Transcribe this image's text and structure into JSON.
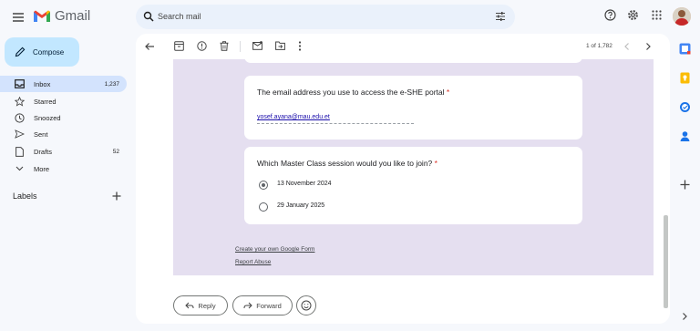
{
  "header": {
    "app_name": "Gmail",
    "search": {
      "placeholder": "Search mail"
    }
  },
  "sidebar": {
    "compose_label": "Compose",
    "items": [
      {
        "label": "Inbox",
        "count": "1,237"
      },
      {
        "label": "Starred",
        "count": ""
      },
      {
        "label": "Snoozed",
        "count": ""
      },
      {
        "label": "Sent",
        "count": ""
      },
      {
        "label": "Drafts",
        "count": "52"
      },
      {
        "label": "More",
        "count": ""
      }
    ],
    "labels_title": "Labels"
  },
  "toolbar": {
    "pager": "1 of 1,782"
  },
  "email": {
    "q1": {
      "title": "The email address you use to access the e-SHE portal",
      "required_mark": "*",
      "answer": "yosef.ayana@mau.edu.et"
    },
    "q2": {
      "title": "Which Master Class session would you like to join?",
      "required_mark": "*",
      "options": [
        {
          "label": "13 November 2024",
          "checked": true
        },
        {
          "label": "29 January 2025",
          "checked": false
        }
      ]
    },
    "footer_links": [
      "Create your own Google Form",
      "Report Abuse"
    ]
  },
  "actions": {
    "reply_label": "Reply",
    "forward_label": "Forward"
  },
  "colors": {
    "compose_bg": "#c2e7ff",
    "inbox_active_bg": "#d3e3fd",
    "form_bg": "#e5dff0",
    "required": "#d93025",
    "link": "#1a0dab"
  },
  "icons": [
    "menu-icon",
    "gmail-logo-icon",
    "search-icon",
    "tune-icon",
    "help-icon",
    "settings-icon",
    "apps-icon",
    "inbox-icon",
    "star-icon",
    "clock-icon",
    "send-icon",
    "draft-icon",
    "chevron-down-icon",
    "plus-icon",
    "back-arrow-icon",
    "archive-icon",
    "report-icon",
    "delete-icon",
    "mark-unread-icon",
    "move-icon",
    "more-vert-icon",
    "chevron-left-icon",
    "chevron-right-icon",
    "reply-icon",
    "forward-icon",
    "emoji-icon",
    "calendar-icon",
    "keep-icon",
    "tasks-icon",
    "contacts-icon"
  ]
}
